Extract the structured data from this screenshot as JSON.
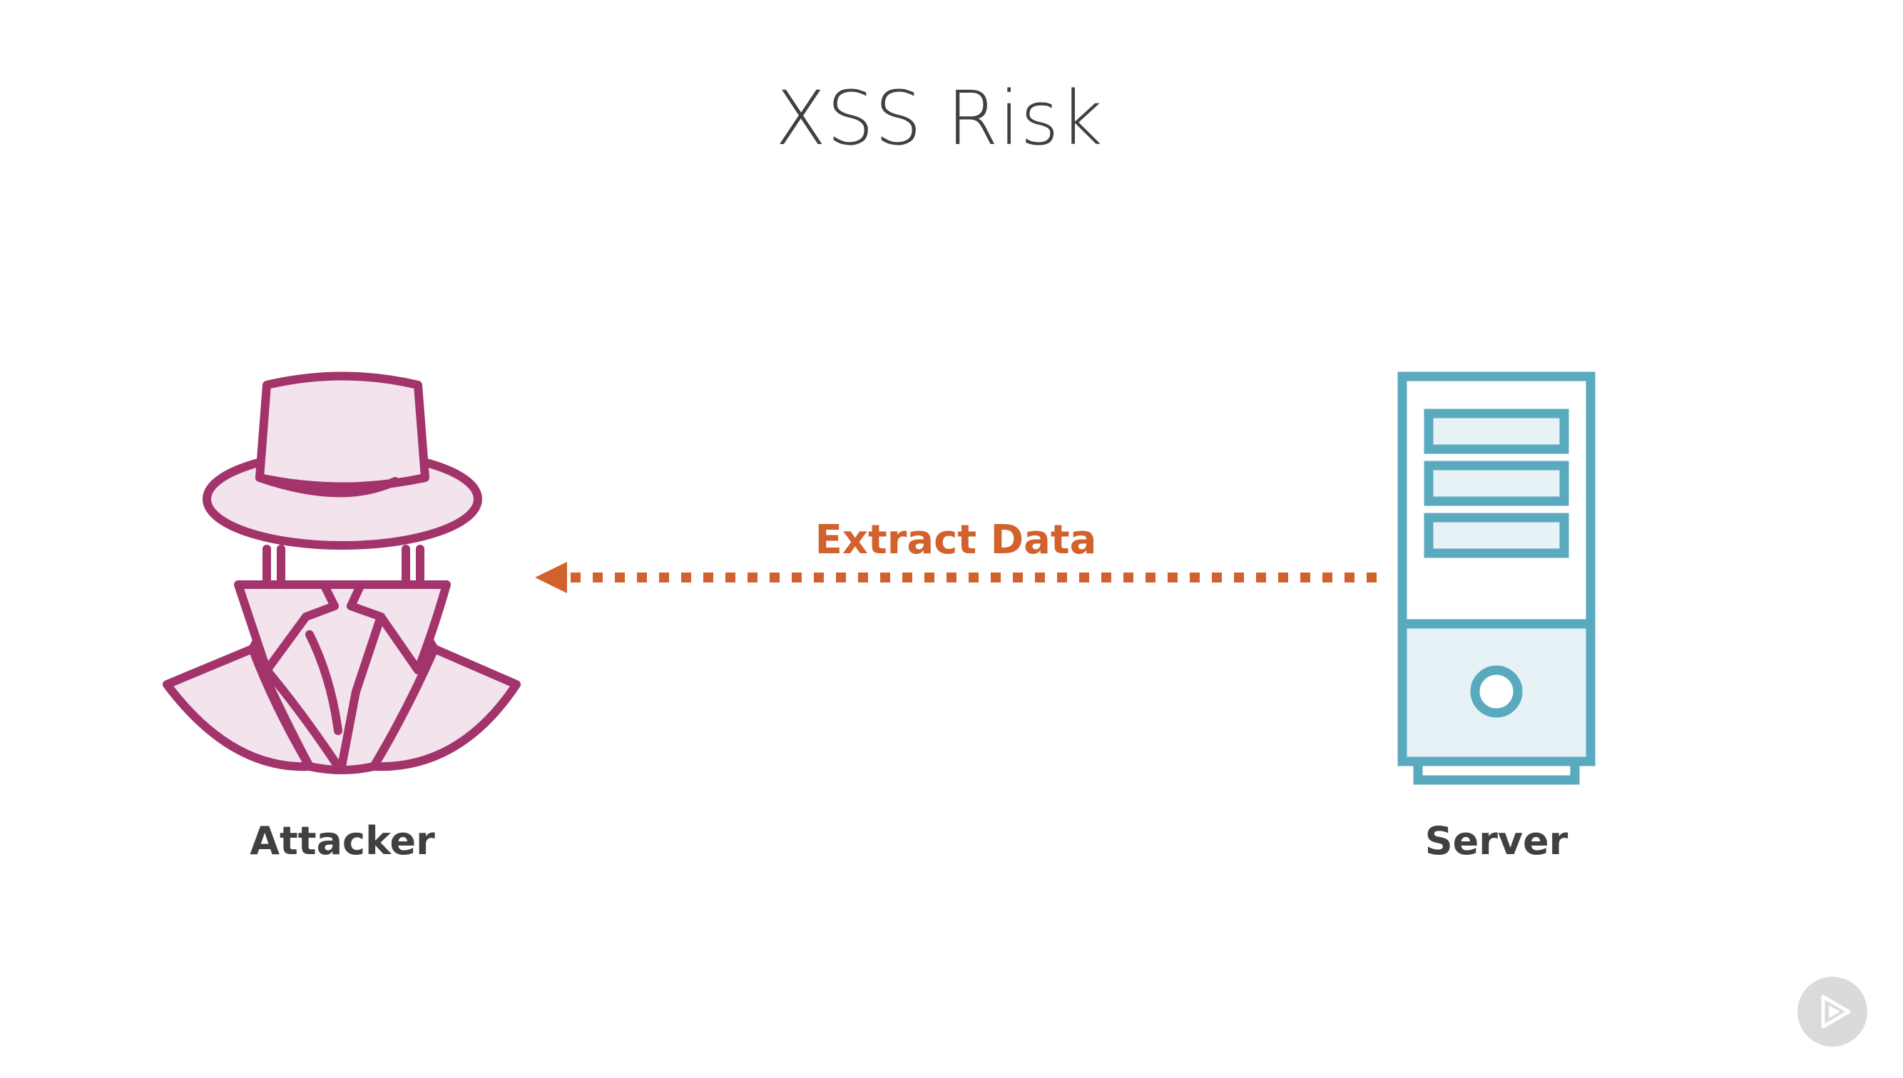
{
  "slide": {
    "title": "XSS Risk"
  },
  "diagram": {
    "attacker": {
      "label": "Attacker",
      "icon": "spy-attacker-icon",
      "stroke_color": "#A3336B",
      "fill_color": "#F2E3EC"
    },
    "server": {
      "label": "Server",
      "icon": "server-tower-icon",
      "stroke_color": "#5AAABF",
      "fill_color": "#E6F2F6"
    },
    "flow": {
      "label": "Extract Data",
      "direction": "server-to-attacker",
      "style": "dotted",
      "color": "#D2622D"
    }
  },
  "player": {
    "icon": "play-badge-icon"
  }
}
